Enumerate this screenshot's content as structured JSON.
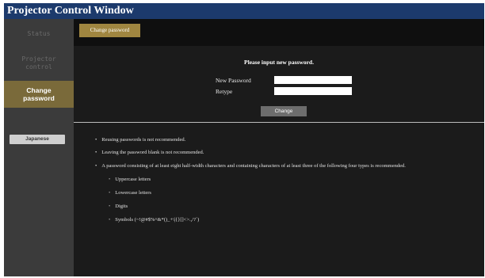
{
  "window": {
    "title": "Projector Control Window"
  },
  "sidebar": {
    "status_label": "Status",
    "projector_label_1": "Projector",
    "projector_label_2": "control",
    "change_label_1": "Change",
    "change_label_2": "password",
    "language_button": "Japanese"
  },
  "topbar": {
    "tab_label": "Change password"
  },
  "form": {
    "heading": "Please input new password.",
    "new_password_label": "New Password",
    "retype_label": "Retype",
    "new_password_value": "",
    "retype_value": "",
    "submit_label": "Change"
  },
  "notes": {
    "bullet": "•",
    "items": [
      "Reusing passwords is not recommended.",
      "Leaving the password blank is not recommended.",
      "A password consisting of at least eight half-width characters and containing characters of at least three of the following four types is recommended."
    ],
    "subitems": [
      "Uppercase letters",
      "Lowercase letters",
      "Digits",
      "Symbols (~!@#$%^&*()_+\\|{}[]<>.,/?`)"
    ]
  }
}
